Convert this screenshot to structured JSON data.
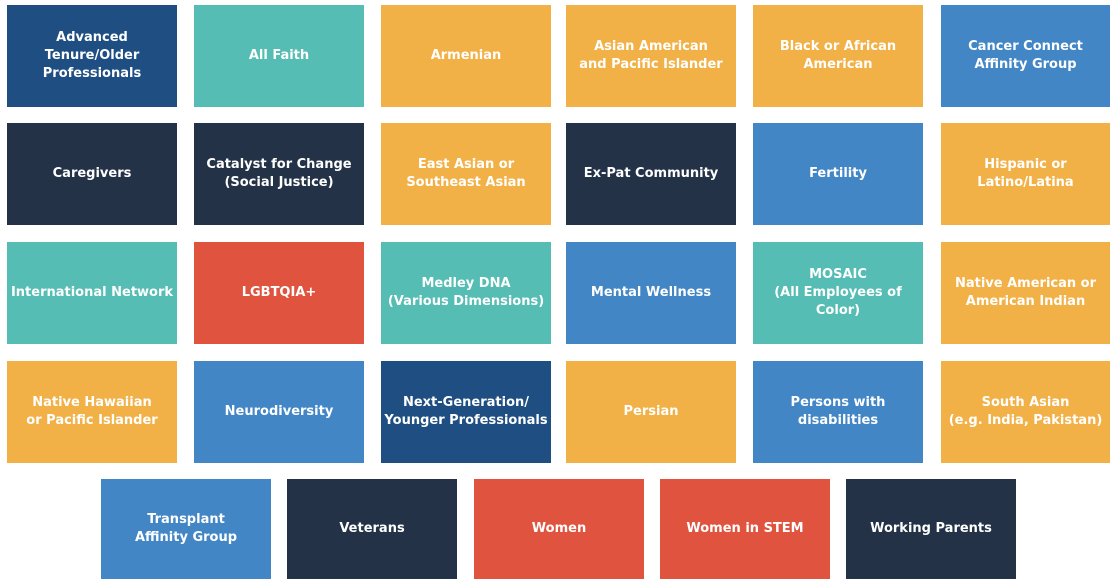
{
  "colors": {
    "navy": "#233247",
    "dark_blue": "#1f4f82",
    "blue": "#4386c6",
    "teal": "#56bdb4",
    "orange": "#f2b147",
    "red": "#e0543f"
  },
  "groups": [
    {
      "label": "Advanced Tenure/Older\nProfessionals",
      "color": "#1f4f82"
    },
    {
      "label": "All Faith",
      "color": "#56bdb4"
    },
    {
      "label": "Armenian",
      "color": "#f2b147"
    },
    {
      "label": "Asian American\nand Pacific Islander",
      "color": "#f2b147"
    },
    {
      "label": "Black or African\nAmerican",
      "color": "#f2b147"
    },
    {
      "label": "Cancer Connect\nAffinity Group",
      "color": "#4386c6"
    },
    {
      "label": "Caregivers",
      "color": "#233247"
    },
    {
      "label": "Catalyst for Change\n(Social Justice)",
      "color": "#233247"
    },
    {
      "label": "East Asian or\nSoutheast Asian",
      "color": "#f2b147"
    },
    {
      "label": "Ex-Pat Community",
      "color": "#233247"
    },
    {
      "label": "Fertility",
      "color": "#4386c6"
    },
    {
      "label": "Hispanic or Latino/Latina",
      "color": "#f2b147"
    },
    {
      "label": "International Network",
      "color": "#56bdb4"
    },
    {
      "label": "LGBTQIA+",
      "color": "#e0543f"
    },
    {
      "label": "Medley DNA\n(Various Dimensions)",
      "color": "#56bdb4"
    },
    {
      "label": "Mental Wellness",
      "color": "#4386c6"
    },
    {
      "label": "MOSAIC\n(All Employees of Color)",
      "color": "#56bdb4"
    },
    {
      "label": "Native American or\nAmerican Indian",
      "color": "#f2b147"
    },
    {
      "label": "Native Hawaiian\nor Pacific Islander",
      "color": "#f2b147"
    },
    {
      "label": "Neurodiversity",
      "color": "#4386c6"
    },
    {
      "label": "Next-Generation/\nYounger Professionals",
      "color": "#1f4f82"
    },
    {
      "label": "Persian",
      "color": "#f2b147"
    },
    {
      "label": "Persons with disabilities",
      "color": "#4386c6"
    },
    {
      "label": "South Asian\n(e.g. India, Pakistan)",
      "color": "#f2b147"
    },
    {
      "label": "Transplant\nAffinity Group",
      "color": "#4386c6"
    },
    {
      "label": "Veterans",
      "color": "#233247"
    },
    {
      "label": "Women",
      "color": "#e0543f"
    },
    {
      "label": "Women in STEM",
      "color": "#e0543f"
    },
    {
      "label": "Working Parents",
      "color": "#233247"
    }
  ]
}
